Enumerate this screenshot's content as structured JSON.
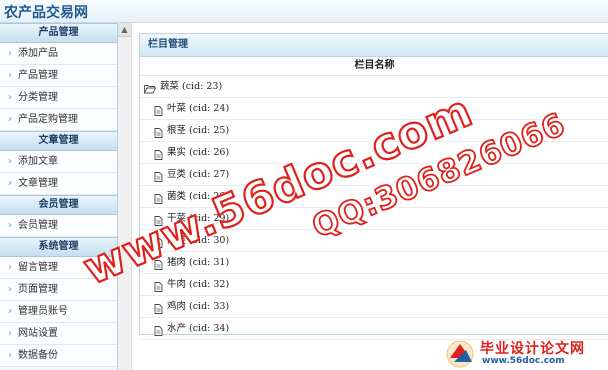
{
  "app": {
    "title": "农产品交易网"
  },
  "sidebar": {
    "sections": [
      {
        "title": "产品管理",
        "items": [
          "添加产品",
          "产品管理",
          "分类管理",
          "产品定购管理"
        ]
      },
      {
        "title": "文章管理",
        "items": [
          "添加文章",
          "文章管理"
        ]
      },
      {
        "title": "会员管理",
        "items": [
          "会员管理"
        ]
      },
      {
        "title": "系统管理",
        "items": [
          "留言管理",
          "页面管理",
          "管理员账号",
          "网站设置",
          "数据备份"
        ]
      }
    ]
  },
  "main": {
    "panel_title": "栏目管理",
    "column_header": "栏目名称",
    "rows": [
      {
        "text": "蔬菜 (cid: 23)",
        "type": "parent",
        "icon": "folder-open-icon"
      },
      {
        "text": "叶菜 (cid: 24)",
        "type": "child",
        "icon": "page-icon"
      },
      {
        "text": "根茎 (cid: 25)",
        "type": "child",
        "icon": "page-icon"
      },
      {
        "text": "果实 (cid: 26)",
        "type": "child",
        "icon": "page-icon"
      },
      {
        "text": "豆类 (cid: 27)",
        "type": "child",
        "icon": "page-icon"
      },
      {
        "text": "菌类 (cid: 28)",
        "type": "child",
        "icon": "page-icon"
      },
      {
        "text": "干菜 (cid: 29)",
        "type": "child",
        "icon": "page-icon"
      },
      {
        "text": "肉类 (cid: 30)",
        "type": "child",
        "icon": "page-icon"
      },
      {
        "text": "猪肉 (cid: 31)",
        "type": "child",
        "icon": "page-icon"
      },
      {
        "text": "牛肉 (cid: 32)",
        "type": "child",
        "icon": "page-icon"
      },
      {
        "text": "鸡肉 (cid: 33)",
        "type": "child",
        "icon": "page-icon"
      },
      {
        "text": "水产 (cid: 34)",
        "type": "child",
        "icon": "page-icon"
      }
    ]
  },
  "watermark": {
    "site": "www.56doc.com",
    "qq": "QQ:306826066",
    "brand_title": "毕业设计论文网",
    "brand_url": "www.56doc.com"
  },
  "colors": {
    "accent": "#1e5a93",
    "watermark": "#e0211b"
  }
}
